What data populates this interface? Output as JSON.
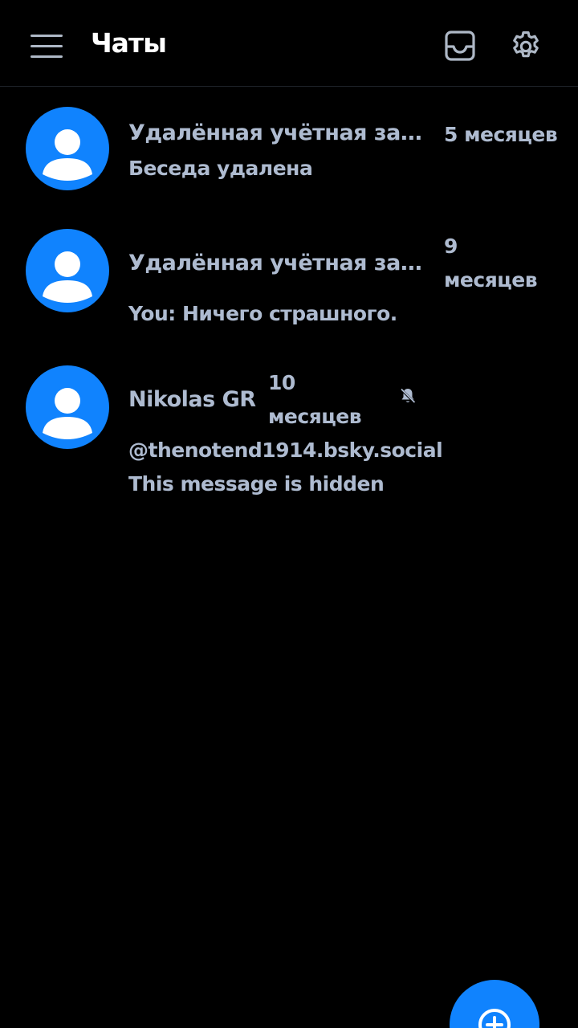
{
  "header": {
    "title": "Чаты",
    "menu_icon": "hamburger-menu-icon",
    "inbox_icon": "inbox-tray-icon",
    "settings_icon": "gear-icon"
  },
  "conversations": [
    {
      "name": "Удалённая учётная запи…",
      "time": "5 месяцев",
      "preview": "Беседа удалена",
      "avatar_icon": "default-avatar-icon"
    },
    {
      "name": "Удалённая учётная запи…",
      "time_line1": "9",
      "time_line2": "месяцев",
      "preview": "You: Ничего страшного.",
      "avatar_icon": "default-avatar-icon"
    },
    {
      "name": "Nikolas GR",
      "time_line1": "10",
      "time_line2": "месяцев",
      "handle": "@thenotend1914.bsky.social",
      "preview": "This message is hidden",
      "muted_icon": "bell-off-icon",
      "avatar_icon": "default-avatar-icon"
    }
  ],
  "fab": {
    "icon": "plus-circle-icon"
  },
  "colors": {
    "background": "#000000",
    "accent": "#1083fe",
    "text_muted": "#aebbd0",
    "title": "#ffffff"
  }
}
